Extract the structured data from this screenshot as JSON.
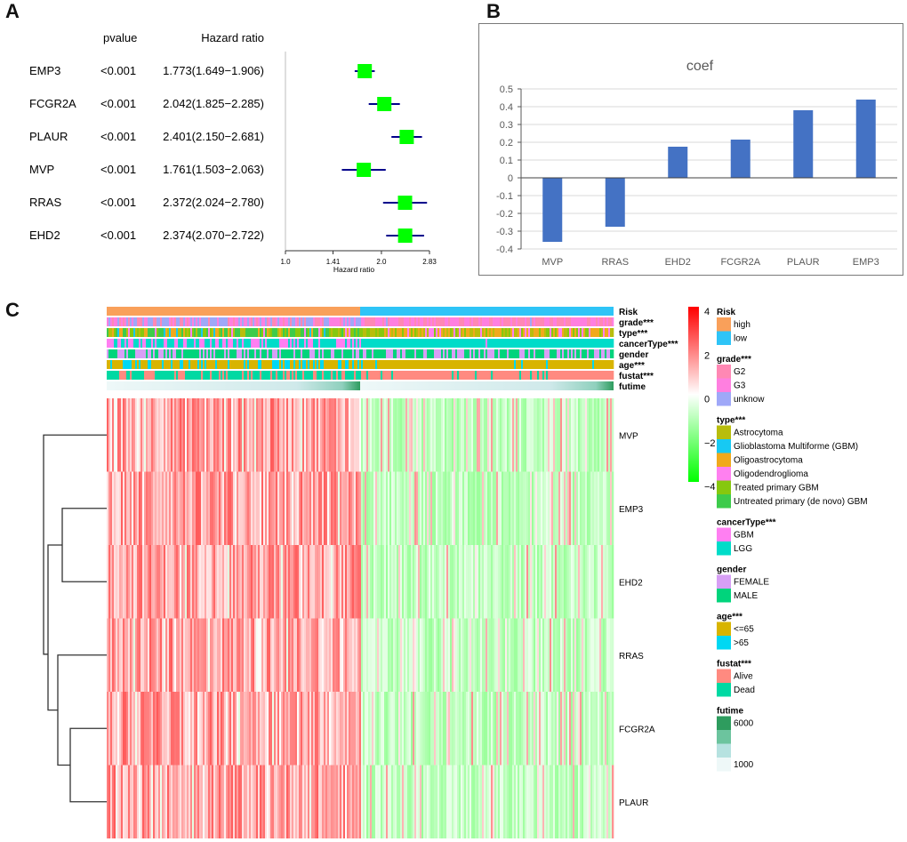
{
  "panels": {
    "a": "A",
    "b": "B",
    "c": "C"
  },
  "chart_data": [
    {
      "id": "forest",
      "type": "scatter",
      "title": "",
      "header": {
        "pvalue": "pvalue",
        "hr": "Hazard ratio"
      },
      "xlabel": "Hazard ratio",
      "xscale": "log",
      "xlim": [
        1.0,
        2.83
      ],
      "xticks": [
        1.0,
        1.41,
        2.0,
        2.83
      ],
      "xtick_labels": [
        "1.0",
        "1.41",
        "2.0",
        "2.83"
      ],
      "colors": {
        "box": "#00ff00",
        "ci": "#00008b",
        "axis": "#333333"
      },
      "rows": [
        {
          "gene": "EMP3",
          "pvalue": "<0.001",
          "hr_text": "1.773(1.649−1.906)",
          "hr": 1.773,
          "lo": 1.649,
          "hi": 1.906
        },
        {
          "gene": "FCGR2A",
          "pvalue": "<0.001",
          "hr_text": "2.042(1.825−2.285)",
          "hr": 2.042,
          "lo": 1.825,
          "hi": 2.285
        },
        {
          "gene": "PLAUR",
          "pvalue": "<0.001",
          "hr_text": "2.401(2.150−2.681)",
          "hr": 2.401,
          "lo": 2.15,
          "hi": 2.681
        },
        {
          "gene": "MVP",
          "pvalue": "<0.001",
          "hr_text": "1.761(1.503−2.063)",
          "hr": 1.761,
          "lo": 1.503,
          "hi": 2.063
        },
        {
          "gene": "RRAS",
          "pvalue": "<0.001",
          "hr_text": "2.372(2.024−2.780)",
          "hr": 2.372,
          "lo": 2.024,
          "hi": 2.78
        },
        {
          "gene": "EHD2",
          "pvalue": "<0.001",
          "hr_text": "2.374(2.070−2.722)",
          "hr": 2.374,
          "lo": 2.07,
          "hi": 2.722
        }
      ]
    },
    {
      "id": "coef",
      "type": "bar",
      "title": "coef",
      "xlabel": "",
      "ylabel": "",
      "categories": [
        "MVP",
        "RRAS",
        "EHD2",
        "FCGR2A",
        "PLAUR",
        "EMP3"
      ],
      "values": [
        -0.36,
        -0.275,
        0.175,
        0.215,
        0.38,
        0.44
      ],
      "ylim": [
        -0.4,
        0.5
      ],
      "yticks": [
        0.5,
        0.4,
        0.3,
        0.2,
        0.1,
        0,
        -0.1,
        -0.2,
        -0.3,
        -0.4
      ],
      "ytick_labels": [
        "0.5",
        "0.4",
        "0.3",
        "0.2",
        "0.1",
        "0",
        "-0.1",
        "-0.2",
        "-0.3",
        "-0.4"
      ],
      "grid": true,
      "colors": {
        "bar": "#4472c4",
        "grid": "#d9d9d9"
      }
    },
    {
      "id": "heatmap",
      "type": "heatmap",
      "title": "",
      "rows": [
        "MVP",
        "EMP3",
        "EHD2",
        "RRAS",
        "FCGR2A",
        "PLAUR"
      ],
      "row_dendrogram": true,
      "high_risk_fraction": 0.5,
      "color_scale": {
        "min": -4,
        "max": 4,
        "ticks": [
          4,
          2,
          0,
          -2,
          -4
        ],
        "low": "#00ff00",
        "mid": "#ffffff",
        "high": "#ff0000"
      },
      "annotations": [
        {
          "name": "Risk",
          "label": "Risk"
        },
        {
          "name": "grade",
          "label": "grade***"
        },
        {
          "name": "type",
          "label": "type***"
        },
        {
          "name": "cancerType",
          "label": "cancerType***"
        },
        {
          "name": "gender",
          "label": "gender"
        },
        {
          "name": "age",
          "label": "age***"
        },
        {
          "name": "fustat",
          "label": "fustat***"
        },
        {
          "name": "futime",
          "label": "futime"
        }
      ],
      "legend": [
        {
          "title": "Risk",
          "items": [
            {
              "label": "high",
              "color": "#f9a05a"
            },
            {
              "label": "low",
              "color": "#2ec4f7"
            }
          ]
        },
        {
          "title": "grade***",
          "items": [
            {
              "label": "G2",
              "color": "#ff88b4"
            },
            {
              "label": "G3",
              "color": "#ff7fe0"
            },
            {
              "label": "unknow",
              "color": "#9fa8f8"
            }
          ]
        },
        {
          "title": "type***",
          "items": [
            {
              "label": "Astrocytoma",
              "color": "#b8bd0c"
            },
            {
              "label": "Glioblastoma Multiforme (GBM)",
              "color": "#17c9f3"
            },
            {
              "label": "Oligoastrocytoma",
              "color": "#f0a91c"
            },
            {
              "label": "Oligodendroglioma",
              "color": "#ff80f0"
            },
            {
              "label": "Treated primary GBM",
              "color": "#86c80e"
            },
            {
              "label": "Untreated primary (de novo) GBM",
              "color": "#3dcb4b"
            }
          ]
        },
        {
          "title": "cancerType***",
          "items": [
            {
              "label": "GBM",
              "color": "#ff7ff2"
            },
            {
              "label": "LGG",
              "color": "#00dcc9"
            }
          ]
        },
        {
          "title": "gender",
          "items": [
            {
              "label": "FEMALE",
              "color": "#d79ff5"
            },
            {
              "label": "MALE",
              "color": "#00d47c"
            }
          ]
        },
        {
          "title": "age***",
          "items": [
            {
              "label": "<=65",
              "color": "#d8b400"
            },
            {
              "label": ">65",
              "color": "#00d8f3"
            }
          ]
        },
        {
          "title": "fustat***",
          "items": [
            {
              "label": "Alive",
              "color": "#ff8a80"
            },
            {
              "label": "Dead",
              "color": "#00d9a3"
            }
          ]
        },
        {
          "title": "futime",
          "items": [
            {
              "label": "6000",
              "color": "#2e9c5e"
            },
            {
              "label": "",
              "color": "#6cc49e"
            },
            {
              "label": "",
              "color": "#b6e2e0"
            },
            {
              "label": "1000",
              "color": "#eef8f8"
            }
          ]
        }
      ]
    }
  ]
}
